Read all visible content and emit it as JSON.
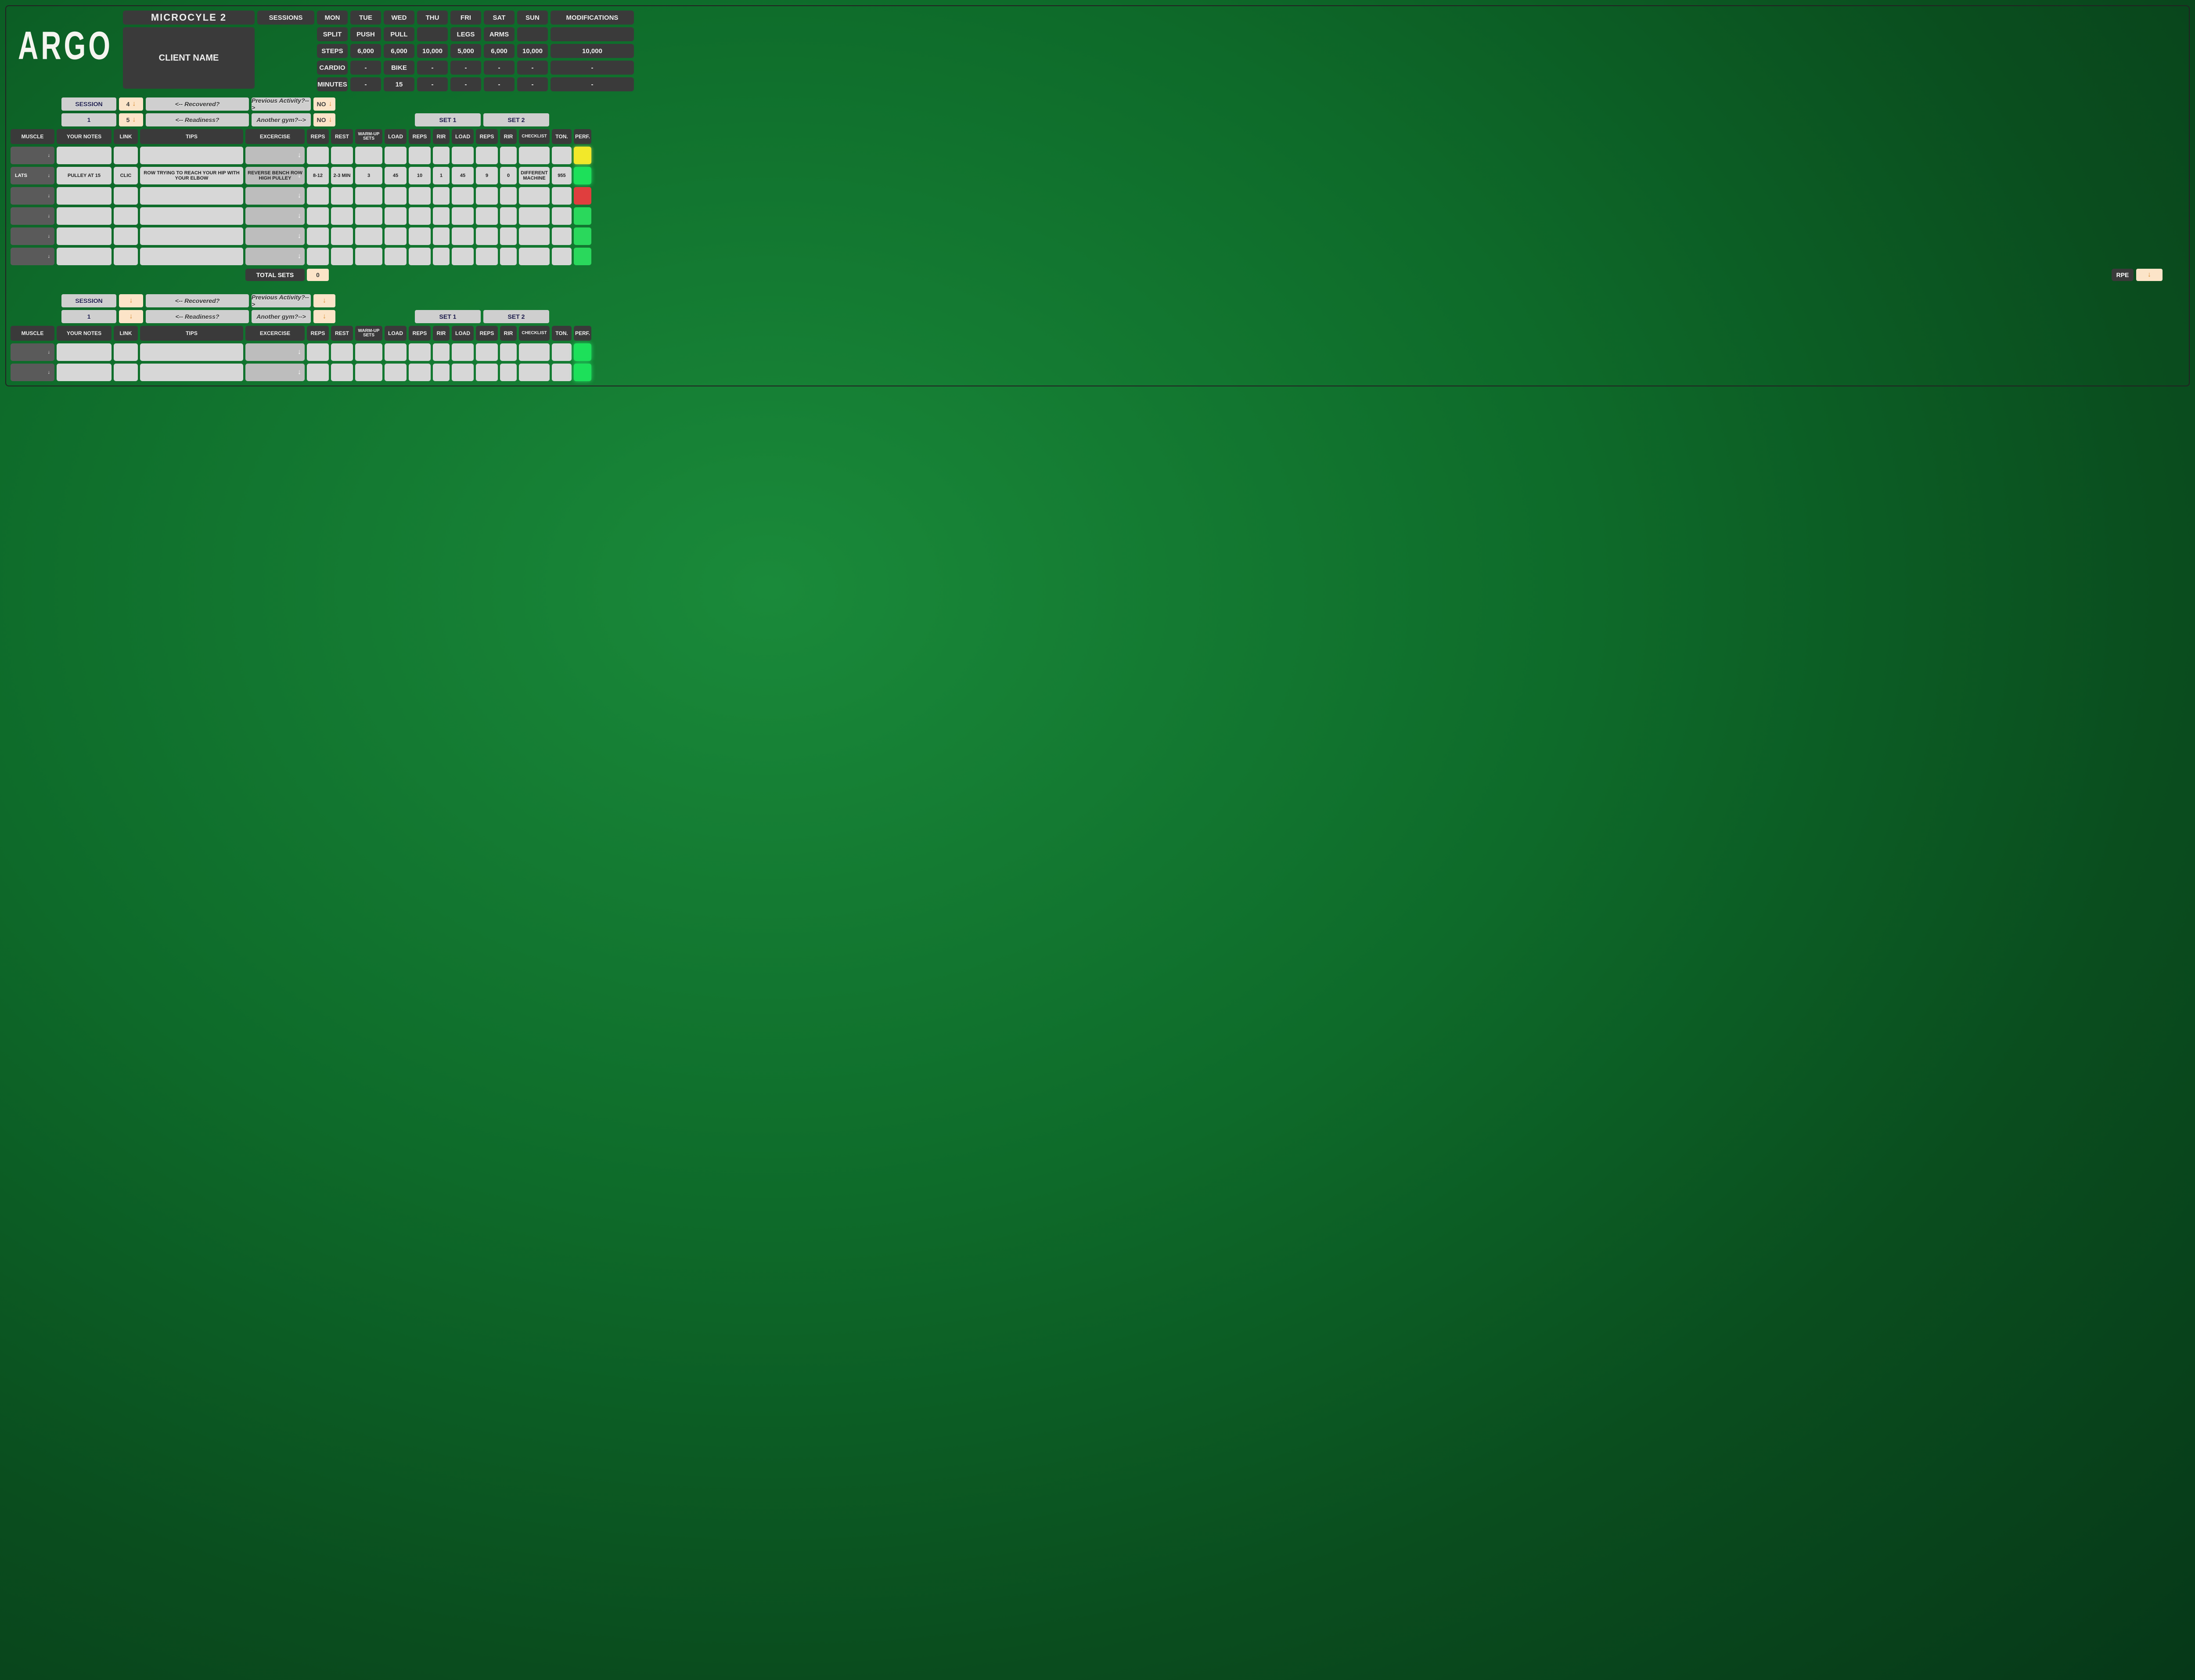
{
  "logo": "ARGO",
  "microcycle": "MICROCYLE 2",
  "client_name": "CLIENT NAME",
  "header": {
    "sessions": "SESSIONS",
    "days": [
      "MON",
      "TUE",
      "WED",
      "THU",
      "FRI",
      "SAT",
      "SUN"
    ],
    "modifications": "MODIFICATIONS",
    "rows": {
      "split": {
        "label": "SPLIT",
        "vals": [
          "PUSH",
          "PULL",
          "",
          "LEGS",
          "ARMS",
          "",
          ""
        ]
      },
      "steps": {
        "label": "STEPS",
        "vals": [
          "6,000",
          "6,000",
          "10,000",
          "5,000",
          "6,000",
          "10,000",
          "10,000"
        ]
      },
      "cardio": {
        "label": "CARDIO",
        "vals": [
          "-",
          "BIKE",
          "-",
          "-",
          "-",
          "-",
          "-"
        ]
      },
      "minutes": {
        "label": "MINUTES",
        "vals": [
          "-",
          "15",
          "-",
          "-",
          "-",
          "-",
          "-"
        ]
      }
    }
  },
  "controls": {
    "session_label": "SESSION",
    "one": "1",
    "recovered_val": "4",
    "readiness_val": "5",
    "recovered_q": "<-- Recovered?",
    "readiness_q": "<-- Readiness?",
    "prev_activity": "Previous Activity?-->",
    "another_gym": "Another gym?-->",
    "no": "NO",
    "set1": "SET 1",
    "set2": "SET 2"
  },
  "columns": {
    "muscle": "MUSCLE",
    "notes": "YOUR NOTES",
    "link": "LINK",
    "tips": "TIPS",
    "exercise": "EXCERCISE",
    "reps": "REPS",
    "rest": "REST",
    "warmup": "WARM-UP\nSETS",
    "load": "LOAD",
    "rir": "RIR",
    "checklist": "CHECKLIST",
    "ton": "TON.",
    "perf": "PERF."
  },
  "rows1": [
    {
      "muscle": "",
      "notes": "",
      "link": "",
      "tips": "",
      "ex": "",
      "reps": "",
      "rest": "",
      "wu": "",
      "s1l": "",
      "s1r": "",
      "s1i": "",
      "s2l": "",
      "s2r": "",
      "s2i": "",
      "chk": "",
      "ton": "",
      "perf": "yellow"
    },
    {
      "muscle": "LATS",
      "notes": "PULLEY AT 15",
      "link": "CLIC",
      "tips": "ROW TRYING TO REACH YOUR HIP WITH YOUR ELBOW",
      "ex": "REVERSE BENCH ROW HIGH PULLEY",
      "reps": "8-12",
      "rest": "2-3 MIN",
      "wu": "3",
      "s1l": "45",
      "s1r": "10",
      "s1i": "1",
      "s2l": "45",
      "s2r": "9",
      "s2i": "0",
      "chk": "DIFFERENT MACHINE",
      "ton": "955",
      "perf": "green"
    },
    {
      "muscle": "",
      "notes": "",
      "link": "",
      "tips": "",
      "ex": "",
      "reps": "",
      "rest": "",
      "wu": "",
      "s1l": "",
      "s1r": "",
      "s1i": "",
      "s2l": "",
      "s2r": "",
      "s2i": "",
      "chk": "",
      "ton": "",
      "perf": "red"
    },
    {
      "muscle": "",
      "notes": "",
      "link": "",
      "tips": "",
      "ex": "",
      "reps": "",
      "rest": "",
      "wu": "",
      "s1l": "",
      "s1r": "",
      "s1i": "",
      "s2l": "",
      "s2r": "",
      "s2i": "",
      "chk": "",
      "ton": "",
      "perf": "bgreen"
    },
    {
      "muscle": "",
      "notes": "",
      "link": "",
      "tips": "",
      "ex": "",
      "reps": "",
      "rest": "",
      "wu": "",
      "s1l": "",
      "s1r": "",
      "s1i": "",
      "s2l": "",
      "s2r": "",
      "s2i": "",
      "chk": "",
      "ton": "",
      "perf": "bgreen"
    },
    {
      "muscle": "",
      "notes": "",
      "link": "",
      "tips": "",
      "ex": "",
      "reps": "",
      "rest": "",
      "wu": "",
      "s1l": "",
      "s1r": "",
      "s1i": "",
      "s2l": "",
      "s2r": "",
      "s2i": "",
      "chk": "",
      "ton": "",
      "perf": "bgreen"
    }
  ],
  "totals": {
    "label": "TOTAL SETS",
    "value": "0",
    "rpe_label": "RPE"
  },
  "rows2": [
    {
      "muscle": "",
      "notes": "",
      "link": "",
      "tips": "",
      "ex": "",
      "reps": "",
      "rest": "",
      "wu": "",
      "s1l": "",
      "s1r": "",
      "s1i": "",
      "s2l": "",
      "s2r": "",
      "s2i": "",
      "chk": "",
      "ton": "",
      "perf": "green"
    },
    {
      "muscle": "",
      "notes": "",
      "link": "",
      "tips": "",
      "ex": "",
      "reps": "",
      "rest": "",
      "wu": "",
      "s1l": "",
      "s1r": "",
      "s1i": "",
      "s2l": "",
      "s2r": "",
      "s2i": "",
      "chk": "",
      "ton": "",
      "perf": "green"
    }
  ]
}
